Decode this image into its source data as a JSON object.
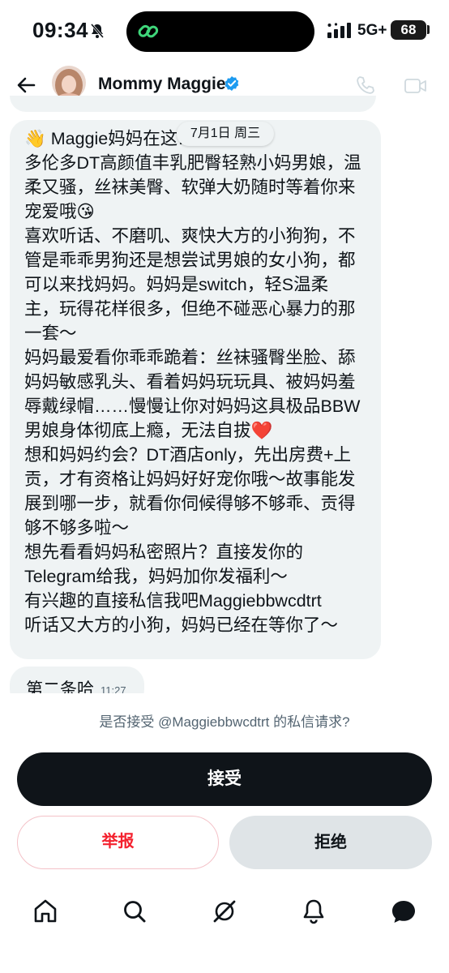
{
  "status_bar": {
    "time": "09:34",
    "network": "5G+",
    "battery": "68"
  },
  "header": {
    "contact_name": "Mommy Maggie",
    "icons": [
      "back-arrow-icon",
      "verified-badge-icon",
      "phone-icon",
      "video-camera-icon"
    ]
  },
  "conversation": {
    "date_pill": "7月1日 周三",
    "message_lines": [
      "👋 Maggie妈妈在这…",
      "多伦多DT高颜值丰乳肥臀轻熟小妈男娘，温",
      "柔又骚，丝袜美臀、软弹大奶随时等着你来",
      "宠爱哦😘",
      "喜欢听话、不磨叽、爽快大方的小狗狗，不",
      "管是乖乖男狗还是想尝试男娘的女小狗，都",
      "可以来找妈妈。妈妈是switch，轻S温柔",
      "主，玩得花样很多，但绝不碰恶心暴力的那",
      "一套～",
      "妈妈最爱看你乖乖跪着：丝袜骚臀坐脸、舔",
      "妈妈敏感乳头、看着妈妈玩玩具、被妈妈羞",
      "辱戴绿帽……慢慢让你对妈妈这具极品BBW",
      "男娘身体彻底上瘾，无法自拔❤️",
      "想和妈妈约会？DT酒店only，先出房费+上",
      "贡，才有资格让妈妈好好宠你哦～故事能发",
      "展到哪一步，就看你伺候得够不够乖、贡得",
      "够不够多啦～",
      "想先看看妈妈私密照片？直接发你的",
      "Telegram给我，妈妈加你发福利～",
      "有兴趣的直接私信我吧Maggiebbwcdtrt",
      "听话又大方的小狗，妈妈已经在等你了～"
    ],
    "second_message": "第二条哈",
    "second_message_time": "11:27"
  },
  "request": {
    "prompt": "是否接受 @Maggiebbwcdtrt 的私信请求?",
    "accept_label": "接受",
    "report_label": "举报",
    "decline_label": "拒绝"
  },
  "bottom_nav": {
    "items": [
      "home-icon",
      "search-icon",
      "grok-icon",
      "notifications-icon",
      "messages-icon"
    ]
  },
  "colors": {
    "bubble": "#eff3f4",
    "accept_bg": "#0f1419",
    "report_text": "#f4212e",
    "decline_bg": "#dfe4e7",
    "verified": "#1d9bf0",
    "island_icon": "#3fd67a"
  }
}
